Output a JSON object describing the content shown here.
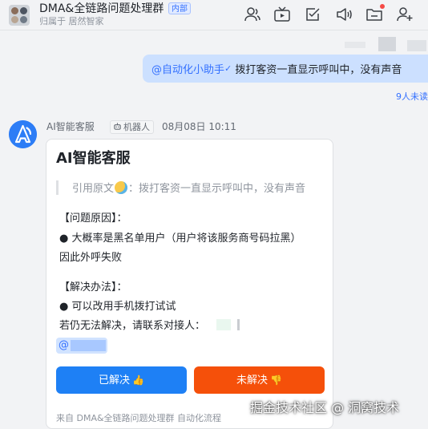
{
  "header": {
    "group_name": "DMA&全链路问题处理群",
    "internal_tag": "内部",
    "org_line": "归属于  居然智家"
  },
  "toolbar": {
    "icons": [
      "members-icon",
      "live-icon",
      "task-icon",
      "announcement-icon",
      "folder-icon",
      "add-member-icon"
    ],
    "notification_color": "#f54a45"
  },
  "sent_message": {
    "mention": "@自动化小助手",
    "text": " 拨打客资一直显示呼叫中，没有声音",
    "read_status": "9人未读"
  },
  "bot": {
    "name": "AI智能客服",
    "tag": "机器人",
    "timestamp": "08月08日 10:11",
    "card": {
      "title": "AI智能客服",
      "quote_prefix": "引用原文",
      "quote_text": "：拨打客资一直显示呼叫中，没有声音",
      "cause_heading": "【问题原因】：",
      "cause_line1": "● 大概率是黑名单用户（用户将该服务商号码拉黑）",
      "cause_line2": "因此外呼失败",
      "solution_heading": "【解决办法】：",
      "solution_line1": "● 可以改用手机拨打试试",
      "solution_line2": "若仍无法解决，请联系对接人：",
      "mention_prefix": "@",
      "resolved_button": "已解决",
      "unresolved_button": "未解决",
      "footer": "来自 DMA&全链路问题处理群 自动化流程"
    }
  },
  "colors": {
    "accent": "#3370ff",
    "resolved": "#1e80f5",
    "unresolved": "#f5500a",
    "sent_bubble": "#cce0ff"
  },
  "watermark": "掘金技术社区 @ 洞窝技术"
}
